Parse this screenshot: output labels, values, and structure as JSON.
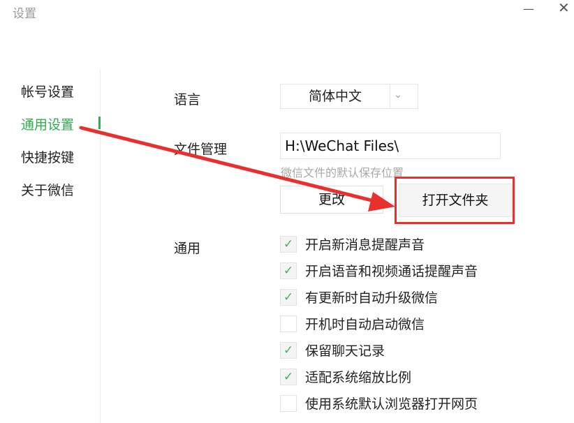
{
  "window": {
    "title": "设置",
    "minimize_icon": "—",
    "close_icon": "✕"
  },
  "nav": {
    "items": [
      {
        "label": "帐号设置",
        "active": false
      },
      {
        "label": "通用设置",
        "active": true
      },
      {
        "label": "快捷按键",
        "active": false
      },
      {
        "label": "关于微信",
        "active": false
      }
    ]
  },
  "language": {
    "label": "语言",
    "value": "简体中文",
    "caret": "⌄"
  },
  "file_management": {
    "label": "文件管理",
    "path": "H:\\WeChat Files\\",
    "hint": "微信文件的默认保存位置",
    "change_label": "更改",
    "open_folder_label": "打开文件夹"
  },
  "general": {
    "label": "通用",
    "options": [
      {
        "label": "开启新消息提醒声音",
        "checked": true
      },
      {
        "label": "开启语音和视频通话提醒声音",
        "checked": true
      },
      {
        "label": "有更新时自动升级微信",
        "checked": true
      },
      {
        "label": "开机时自动启动微信",
        "checked": false
      },
      {
        "label": "保留聊天记录",
        "checked": true
      },
      {
        "label": "适配系统缩放比例",
        "checked": true
      },
      {
        "label": "使用系统默认浏览器打开网页",
        "checked": false
      }
    ]
  },
  "check_glyph": "✓",
  "colors": {
    "accent": "#2fae4a",
    "annotation": "#e8312c"
  }
}
